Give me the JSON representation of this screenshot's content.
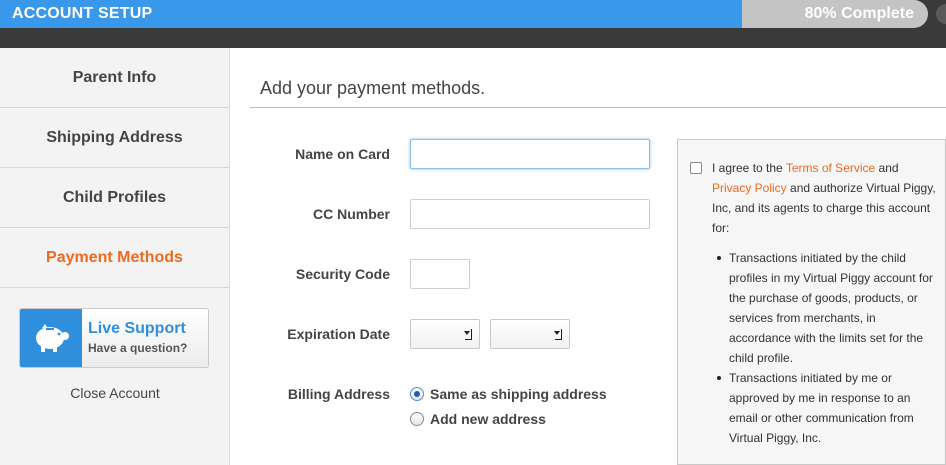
{
  "header": {
    "title": "ACCOUNT SETUP",
    "progress_text": "80% Complete",
    "progress": 0.8
  },
  "sidebar": {
    "items": [
      {
        "label": "Parent Info"
      },
      {
        "label": "Shipping Address"
      },
      {
        "label": "Child Profiles"
      },
      {
        "label": "Payment Methods",
        "active": true
      }
    ],
    "support": {
      "title": "Live Support",
      "subtitle": "Have a question?"
    },
    "close_account": "Close Account"
  },
  "main": {
    "title": "Add your payment methods.",
    "form": {
      "name_label": "Name on Card",
      "name_value": "",
      "cc_label": "CC Number",
      "cc_value": "",
      "security_label": "Security Code",
      "security_value": "",
      "expiration_label": "Expiration Date",
      "expiration_month": "",
      "expiration_year": "",
      "billing_label": "Billing Address",
      "billing_options": [
        {
          "label": "Same as shipping address",
          "checked": true
        },
        {
          "label": "Add new address",
          "checked": false
        }
      ]
    },
    "terms": {
      "checked": false,
      "prefix": "I agree to the ",
      "tos_link": "Terms of Service",
      "and": " and ",
      "privacy_link": "Privacy Policy",
      "suffix": " and authorize Virtual Piggy, Inc, and its agents to charge this account for:",
      "bullets": [
        "Transactions initiated by the child profiles in my Virtual Piggy account for the purchase of goods, products, or services from merchants, in accordance with the limits set for the child profile.",
        "Transactions initiated by me or approved by me in response to an email or other communication from Virtual Piggy, Inc."
      ]
    }
  },
  "colors": {
    "accent_orange": "#ee6a1f",
    "progress_blue": "#3a98ea",
    "support_blue": "#2f8fdd"
  }
}
